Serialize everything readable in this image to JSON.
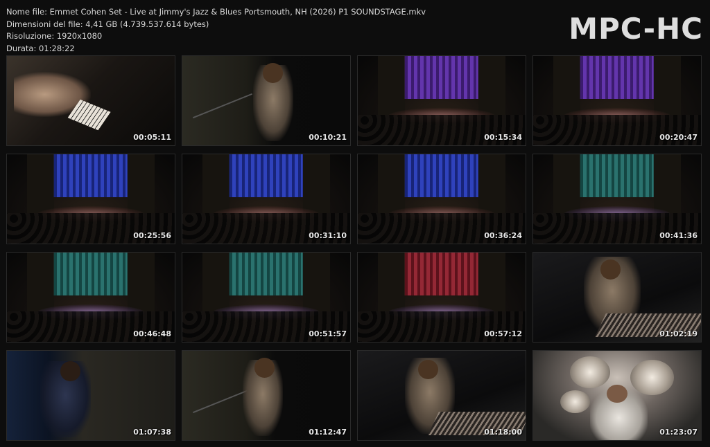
{
  "info": {
    "filename": "Nome file: Emmet Cohen Set - Live at Jimmy's Jazz & Blues Portsmouth, NH (2026) P1 SOUNDSTAGE.mkv",
    "filesize": "Dimensioni del file: 4,41 GB (4.739.537.614 bytes)",
    "resolution": "Risoluzione: 1920x1080",
    "duration": "Durata: 01:28:22"
  },
  "logo": "MPC-HC",
  "thumbnails": [
    {
      "time": "00:05:11",
      "scene": "piano-hands"
    },
    {
      "time": "00:10:21",
      "scene": "singer"
    },
    {
      "time": "00:15:34",
      "scene": "stage-purple"
    },
    {
      "time": "00:20:47",
      "scene": "stage-purple"
    },
    {
      "time": "00:25:56",
      "scene": "stage-blue"
    },
    {
      "time": "00:31:10",
      "scene": "stage-blue"
    },
    {
      "time": "00:36:24",
      "scene": "stage-blue"
    },
    {
      "time": "00:41:36",
      "scene": "stage-teal"
    },
    {
      "time": "00:46:48",
      "scene": "stage-teal"
    },
    {
      "time": "00:51:57",
      "scene": "stage-teal"
    },
    {
      "time": "00:57:12",
      "scene": "stage-red"
    },
    {
      "time": "01:02:19",
      "scene": "pianist-closeup"
    },
    {
      "time": "01:07:38",
      "scene": "trumpet-player"
    },
    {
      "time": "01:12:47",
      "scene": "singer"
    },
    {
      "time": "01:18:00",
      "scene": "pianist-closeup"
    },
    {
      "time": "01:23:07",
      "scene": "drums-overhead"
    }
  ]
}
